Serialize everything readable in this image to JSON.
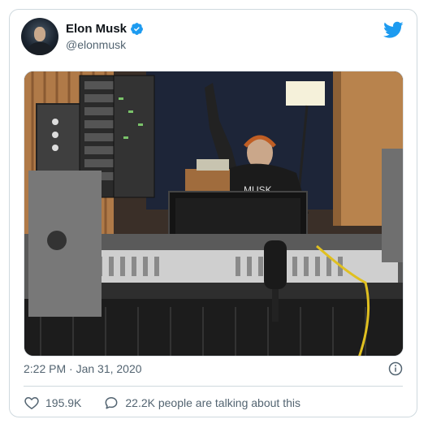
{
  "tweet": {
    "author": {
      "display_name": "Elon Musk",
      "handle": "@elonmusk",
      "verified": true
    },
    "image": {
      "description_icon": "studio-photo"
    },
    "timestamp": "2:22 PM · Jan 31, 2020",
    "likes": "195.9K",
    "conversation": "22.2K people are talking about this"
  },
  "colors": {
    "twitter_blue": "#1d9bf0",
    "secondary_text": "#536471",
    "border": "#cfd9de"
  },
  "icons": {
    "brand": "twitter-bird-icon",
    "verified": "verified-badge-icon",
    "info": "info-icon",
    "like": "heart-icon",
    "reply": "chat-bubble-icon"
  }
}
